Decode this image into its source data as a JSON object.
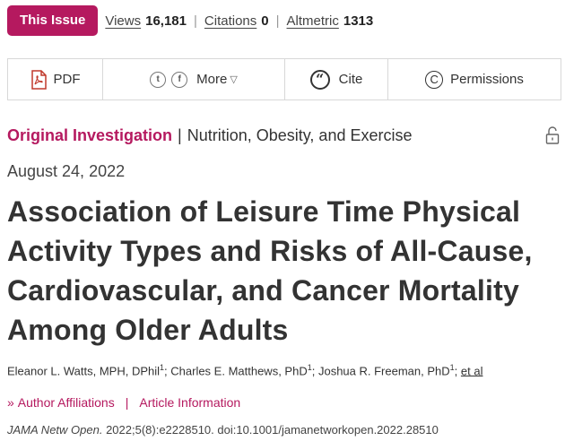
{
  "metrics": {
    "issue_label": "This Issue",
    "views_label": "Views",
    "views_value": "16,181",
    "citations_label": "Citations",
    "citations_value": "0",
    "altmetric_label": "Altmetric",
    "altmetric_value": "1313"
  },
  "toolbar": {
    "pdf_label": "PDF",
    "twitter_icon": "t",
    "facebook_icon": "f",
    "more_label": "More",
    "cite_label": "Cite",
    "permissions_label": "Permissions"
  },
  "article": {
    "type": "Original Investigation",
    "separator": "|",
    "topic": "Nutrition, Obesity, and Exercise",
    "date": "August 24, 2022",
    "title": "Association of Leisure Time Physical Activity Types and Risks of All-Cause, Cardiovascular, and Cancer Mortality Among Older Adults",
    "authors": [
      {
        "name": "Eleanor L. Watts, MPH, DPhil",
        "sup": "1"
      },
      {
        "name": "Charles E. Matthews, PhD",
        "sup": "1"
      },
      {
        "name": "Joshua R. Freeman, PhD",
        "sup": "1"
      }
    ],
    "et_al": "et al",
    "author_affiliations": "Author Affiliations",
    "article_information": "Article Information",
    "journal": "JAMA Netw Open.",
    "citation_rest": " 2022;5(8):e2228510. doi:10.1001/jamanetworkopen.2022.28510"
  },
  "colors": {
    "accent": "#b5195f"
  }
}
